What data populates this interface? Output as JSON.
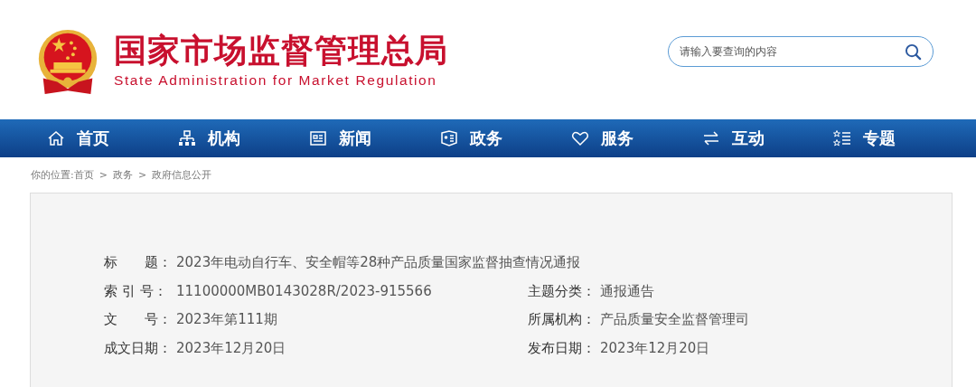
{
  "header": {
    "title": "国家市场监督管理总局",
    "subtitle": "State Administration for Market Regulation",
    "search": {
      "placeholder": "请输入要查询的内容"
    }
  },
  "nav": [
    {
      "label": "首页",
      "kind": "home"
    },
    {
      "label": "机构",
      "kind": "org"
    },
    {
      "label": "新闻",
      "kind": "news"
    },
    {
      "label": "政务",
      "kind": "affairs"
    },
    {
      "label": "服务",
      "kind": "service"
    },
    {
      "label": "互动",
      "kind": "interact"
    },
    {
      "label": "专题",
      "kind": "topics"
    }
  ],
  "breadcrumb": {
    "prefix": "你的位置:",
    "items": [
      "首页",
      "政务",
      "政府信息公开"
    ],
    "separator": ">"
  },
  "info": {
    "title": {
      "label": "标　　题：",
      "value": "2023年电动自行车、安全帽等28种产品质量国家监督抽查情况通报"
    },
    "rows": [
      {
        "left": {
          "label": "索 引 号：",
          "value": "11100000MB0143028R/2023-915566"
        },
        "right": {
          "label": "主题分类：",
          "value": "通报通告"
        }
      },
      {
        "left": {
          "label": "文　　号：",
          "value": "2023年第111期"
        },
        "right": {
          "label": "所属机构：",
          "value": "产品质量安全监督管理司"
        }
      },
      {
        "left": {
          "label": "成文日期：",
          "value": "2023年12月20日"
        },
        "right": {
          "label": "发布日期：",
          "value": "2023年12月20日"
        }
      }
    ]
  }
}
